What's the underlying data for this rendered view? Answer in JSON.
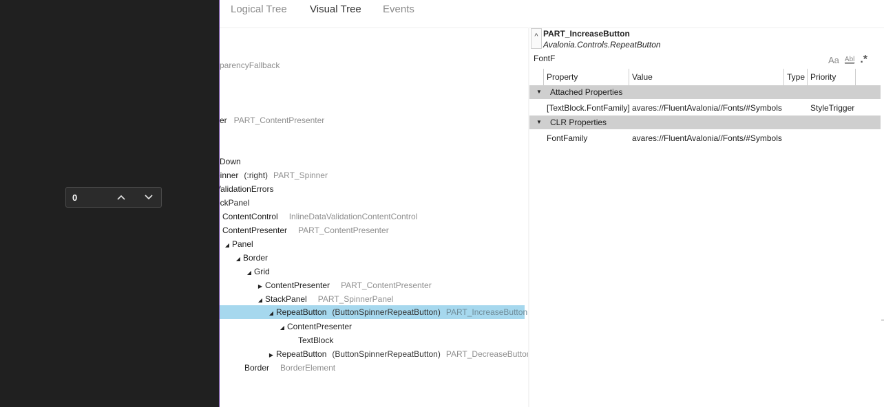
{
  "app_preview": {
    "spinner": {
      "value": "0",
      "up_icon": "chevron-up-icon",
      "down_icon": "chevron-down-icon"
    }
  },
  "tabs": [
    {
      "label": "Logical Tree",
      "active": false
    },
    {
      "label": "Visual Tree",
      "active": true
    },
    {
      "label": "Events",
      "active": false
    }
  ],
  "tree": {
    "nodes": [
      {
        "name": "sparencyFallback",
        "class": "",
        "part": ""
      },
      {
        "name": "yer",
        "class": "",
        "part": "PART_ContentPresenter"
      },
      {
        "name": "Down",
        "class": "",
        "part": ""
      },
      {
        "name": "pinner",
        "class": "(:right)",
        "part": "PART_Spinner"
      },
      {
        "name": "ValidationErrors",
        "class": "",
        "part": ""
      },
      {
        "name": "ockPanel",
        "class": "",
        "part": ""
      },
      {
        "name": "ContentControl",
        "class": "",
        "part": "InlineDataValidationContentControl"
      },
      {
        "name": "ContentPresenter",
        "class": "",
        "part": "PART_ContentPresenter"
      },
      {
        "name": "Panel",
        "class": "",
        "part": ""
      },
      {
        "name": "Border",
        "class": "",
        "part": ""
      },
      {
        "name": "Grid",
        "class": "",
        "part": ""
      },
      {
        "name": "ContentPresenter",
        "class": "",
        "part": "PART_ContentPresenter"
      },
      {
        "name": "StackPanel",
        "class": "",
        "part": "PART_SpinnerPanel"
      },
      {
        "name": "RepeatButton",
        "class": "(ButtonSpinnerRepeatButton)",
        "part": "PART_IncreaseButton"
      },
      {
        "name": "ContentPresenter",
        "class": "",
        "part": ""
      },
      {
        "name": "TextBlock",
        "class": "",
        "part": ""
      },
      {
        "name": "RepeatButton",
        "class": "(ButtonSpinnerRepeatButton)",
        "part": "PART_DecreaseButton"
      },
      {
        "name": "Border",
        "class": "",
        "part": "BorderElement"
      }
    ]
  },
  "details": {
    "collapse_label": "^",
    "selected_name": "PART_IncreaseButton",
    "selected_type": "Avalonia.Controls.RepeatButton",
    "filter_text": "FontF",
    "filter_tools": {
      "case": "Aa",
      "word": "Abl",
      "regex": ".*"
    },
    "columns": [
      "Property",
      "Value",
      "Type",
      "Priority"
    ],
    "groups": [
      {
        "name": "Attached Properties",
        "rows": [
          {
            "property": "[TextBlock.FontFamily]",
            "value": "avares://FluentAvalonia//Fonts/#Symbols",
            "type": "",
            "priority": "StyleTrigger"
          }
        ]
      },
      {
        "name": "CLR Properties",
        "rows": [
          {
            "property": "FontFamily",
            "value": "avares://FluentAvalonia//Fonts/#Symbols",
            "type": "",
            "priority": ""
          }
        ]
      }
    ]
  }
}
